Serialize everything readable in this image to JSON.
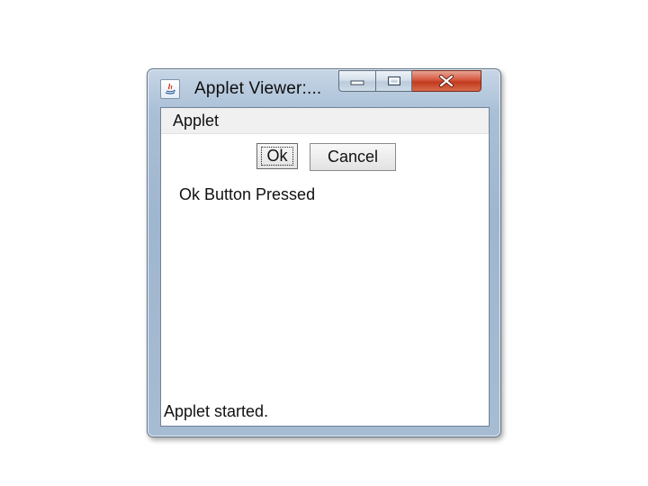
{
  "window": {
    "title": "Applet Viewer:...",
    "icon": "java-icon",
    "caption_buttons": {
      "minimize_icon": "minimize-icon",
      "maximize_icon": "maximize-icon",
      "close_icon": "close-icon"
    }
  },
  "applet": {
    "menu_label": "Applet",
    "buttons": {
      "ok_label": "Ok",
      "cancel_label": "Cancel"
    },
    "message": "Ok Button Pressed"
  },
  "status_bar": {
    "text": "Applet started."
  },
  "colors": {
    "frame": "#a9bfd6",
    "close_button": "#c23a1e",
    "client_background": "#ffffff",
    "menu_background": "#f0f0f0"
  }
}
